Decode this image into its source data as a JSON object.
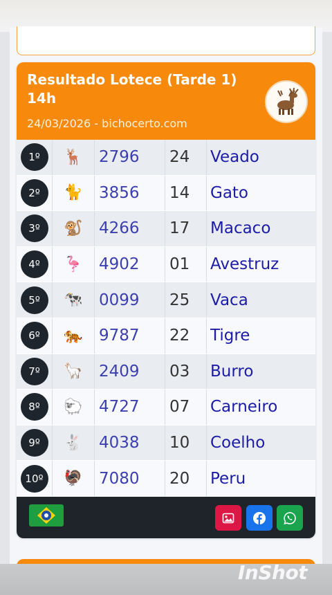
{
  "card": {
    "title": "Resultado Lotece (Tarde 1) 14h",
    "subtitle": "24/03/2026 - bichocerto.com",
    "header_icon": "deer-icon"
  },
  "results": [
    {
      "pos": "1º",
      "emoji": "🦌",
      "number": "2796",
      "group": "24",
      "animal": "Veado"
    },
    {
      "pos": "2º",
      "emoji": "🐈",
      "number": "3856",
      "group": "14",
      "animal": "Gato"
    },
    {
      "pos": "3º",
      "emoji": "🐒",
      "number": "4266",
      "group": "17",
      "animal": "Macaco"
    },
    {
      "pos": "4º",
      "emoji": "🦩",
      "number": "4902",
      "group": "01",
      "animal": "Avestruz"
    },
    {
      "pos": "5º",
      "emoji": "🐄",
      "number": "0099",
      "group": "25",
      "animal": "Vaca"
    },
    {
      "pos": "6º",
      "emoji": "🐅",
      "number": "9787",
      "group": "22",
      "animal": "Tigre"
    },
    {
      "pos": "7º",
      "emoji": "🦙",
      "number": "2409",
      "group": "03",
      "animal": "Burro"
    },
    {
      "pos": "8º",
      "emoji": "🐑",
      "number": "4727",
      "group": "07",
      "animal": "Carneiro"
    },
    {
      "pos": "9º",
      "emoji": "🐇",
      "number": "4038",
      "group": "10",
      "animal": "Coelho"
    },
    {
      "pos": "10º",
      "emoji": "🦃",
      "number": "7080",
      "group": "20",
      "animal": "Peru"
    }
  ],
  "footer": {
    "flag_icon": "brazil-flag-icon",
    "buttons": [
      "image-icon",
      "facebook-icon",
      "whatsapp-icon"
    ]
  },
  "watermark": "InShot"
}
